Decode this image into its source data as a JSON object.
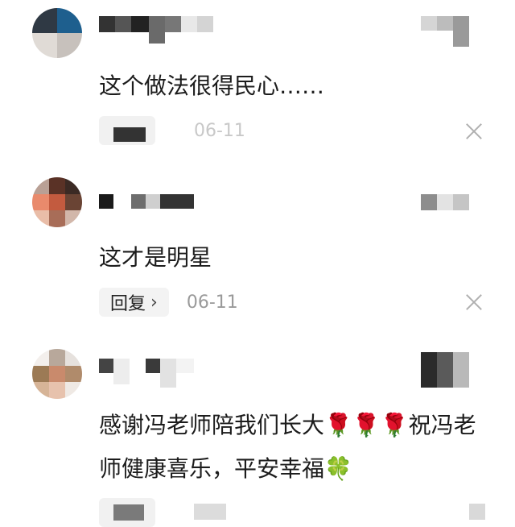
{
  "comments": [
    {
      "text": "这个做法很得民心……",
      "reply_label": "",
      "date": "06-11",
      "avatar_colors": [
        "#2c3a4a",
        "#e6e0dc",
        "#53616f",
        "#c9c2bd"
      ]
    },
    {
      "text": "这才是明星",
      "reply_label": "回复",
      "date": "06-11",
      "avatar_colors": [
        "#3b2a24",
        "#e89676",
        "#6a4434",
        "#c9a79a"
      ]
    },
    {
      "text": "感谢冯老师陪我们长大🌹🌹🌹祝冯老师健康喜乐，平安幸福🍀",
      "reply_label": "",
      "date": "",
      "avatar_colors": [
        "#9c7a55",
        "#c98a6c",
        "#d6b497",
        "#efe9e4"
      ]
    }
  ],
  "icons": {
    "reply_chevron": "›",
    "close": "close-icon"
  }
}
